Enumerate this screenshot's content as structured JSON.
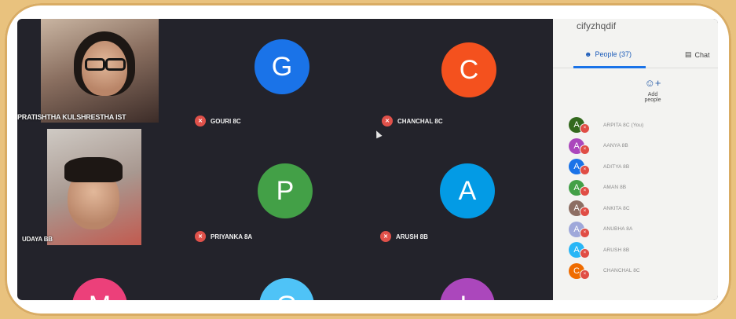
{
  "meeting": {
    "code": "cifyzhqdif"
  },
  "tabs": {
    "people_label": "People (37)",
    "chat_label": "Chat"
  },
  "add_people_label": "Add people",
  "video_tiles": [
    {
      "name": "PRATISHTHA KULSHRESTHA IST"
    },
    {
      "name": "UDAYA BB"
    }
  ],
  "avatar_tiles": [
    {
      "letter": "G",
      "name": "GOURI 8C",
      "color": "#1a73e8"
    },
    {
      "letter": "C",
      "name": "CHANCHAL 8C",
      "color": "#f4511e"
    },
    {
      "letter": "P",
      "name": "PRIYANKA 8A",
      "color": "#43a047"
    },
    {
      "letter": "A",
      "name": "ARUSH 8B",
      "color": "#039be5"
    },
    {
      "letter": "M",
      "name": "",
      "color": "#ec407a"
    },
    {
      "letter": "G",
      "name": "",
      "color": "#4fc3f7"
    },
    {
      "letter": "L",
      "name": "",
      "color": "#ab47bc"
    }
  ],
  "participants": [
    {
      "letter": "A",
      "name": "ARPITA 8C (You)",
      "color": "#33691e"
    },
    {
      "letter": "A",
      "name": "AANYA 8B",
      "color": "#ab47bc"
    },
    {
      "letter": "A",
      "name": "ADITYA 8B",
      "color": "#1a73e8"
    },
    {
      "letter": "A",
      "name": "AMAN 8B",
      "color": "#43a047"
    },
    {
      "letter": "A",
      "name": "ANKITA 8C",
      "color": "#8d6e63"
    },
    {
      "letter": "A",
      "name": "ANUBHA 8A",
      "color": "#9fa8da"
    },
    {
      "letter": "A",
      "name": "ARUSH 8B",
      "color": "#29b6f6"
    },
    {
      "letter": "C",
      "name": "CHANCHAL 8C",
      "color": "#ef6c00"
    }
  ]
}
